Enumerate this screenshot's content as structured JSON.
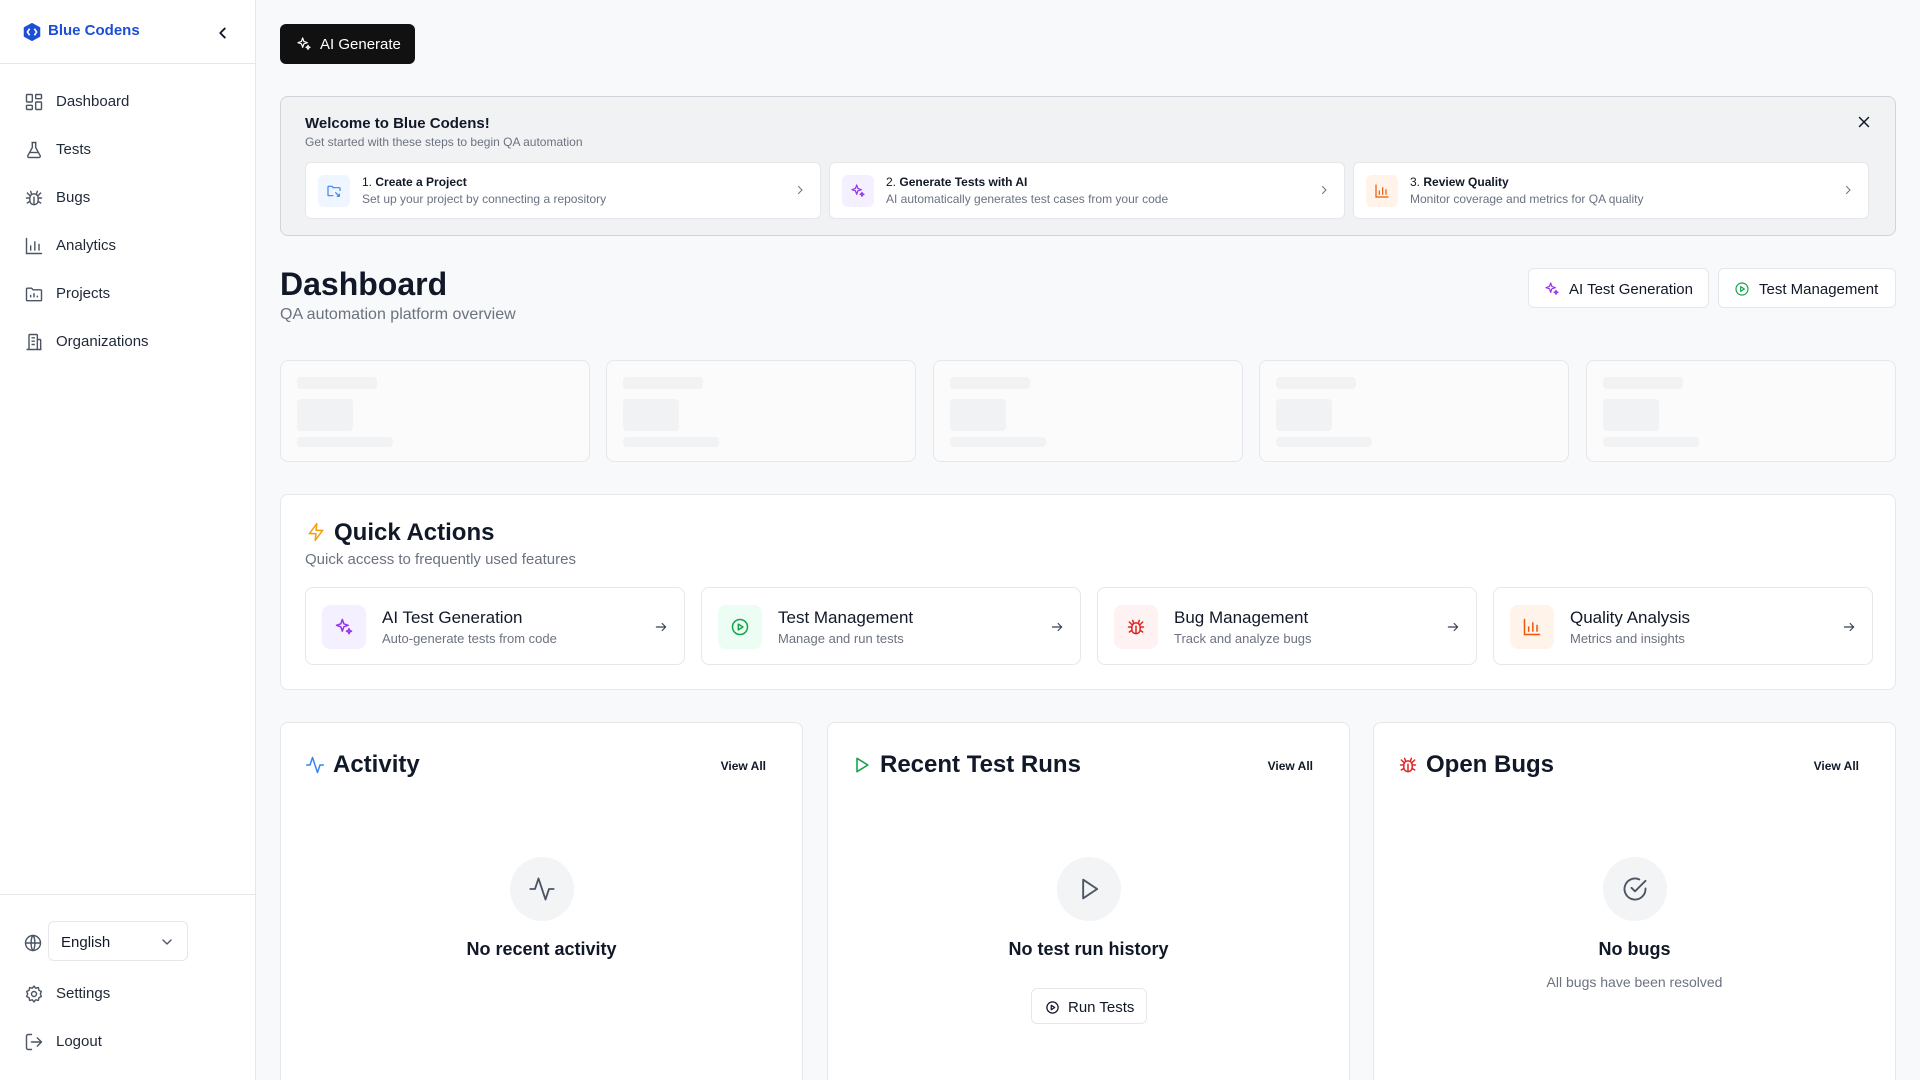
{
  "sidebar": {
    "brand": "Blue Codens",
    "nav": [
      {
        "label": "Dashboard",
        "icon": "dashboard-icon"
      },
      {
        "label": "Tests",
        "icon": "flask-icon"
      },
      {
        "label": "Bugs",
        "icon": "bug-icon"
      },
      {
        "label": "Analytics",
        "icon": "bar-chart-icon"
      },
      {
        "label": "Projects",
        "icon": "folder-icon"
      },
      {
        "label": "Organizations",
        "icon": "building-icon"
      }
    ],
    "language": "English",
    "settings_label": "Settings",
    "logout_label": "Logout"
  },
  "toolbar": {
    "ai_generate_label": "AI Generate"
  },
  "welcome": {
    "title": "Welcome to Blue Codens!",
    "subtitle": "Get started with these steps to begin QA automation",
    "steps": [
      {
        "num": "1.",
        "title": "Create a Project",
        "desc": "Set up your project by connecting a repository"
      },
      {
        "num": "2.",
        "title": "Generate Tests with AI",
        "desc": "AI automatically generates test cases from your code"
      },
      {
        "num": "3.",
        "title": "Review Quality",
        "desc": "Monitor coverage and metrics for QA quality"
      }
    ]
  },
  "header": {
    "title": "Dashboard",
    "subtitle": "QA automation platform overview",
    "ai_test_gen_label": "AI Test Generation",
    "test_mgmt_label": "Test Management"
  },
  "quick_actions": {
    "title": "Quick Actions",
    "subtitle": "Quick access to frequently used features",
    "items": [
      {
        "title": "AI Test Generation",
        "desc": "Auto-generate tests from code"
      },
      {
        "title": "Test Management",
        "desc": "Manage and run tests"
      },
      {
        "title": "Bug Management",
        "desc": "Track and analyze bugs"
      },
      {
        "title": "Quality Analysis",
        "desc": "Metrics and insights"
      }
    ]
  },
  "panels": {
    "activity": {
      "title": "Activity",
      "view_all": "View All",
      "empty_title": "No recent activity"
    },
    "test_runs": {
      "title": "Recent Test Runs",
      "view_all": "View All",
      "empty_title": "No test run history",
      "run_label": "Run Tests"
    },
    "bugs": {
      "title": "Open Bugs",
      "view_all": "View All",
      "empty_title": "No bugs",
      "empty_desc": "All bugs have been resolved"
    }
  },
  "colors": {
    "brand": "#1d4ed8",
    "purple": "#9333ea",
    "green": "#16a34a",
    "red": "#dc2626",
    "orange": "#ea580c",
    "amber": "#f59e0b"
  }
}
